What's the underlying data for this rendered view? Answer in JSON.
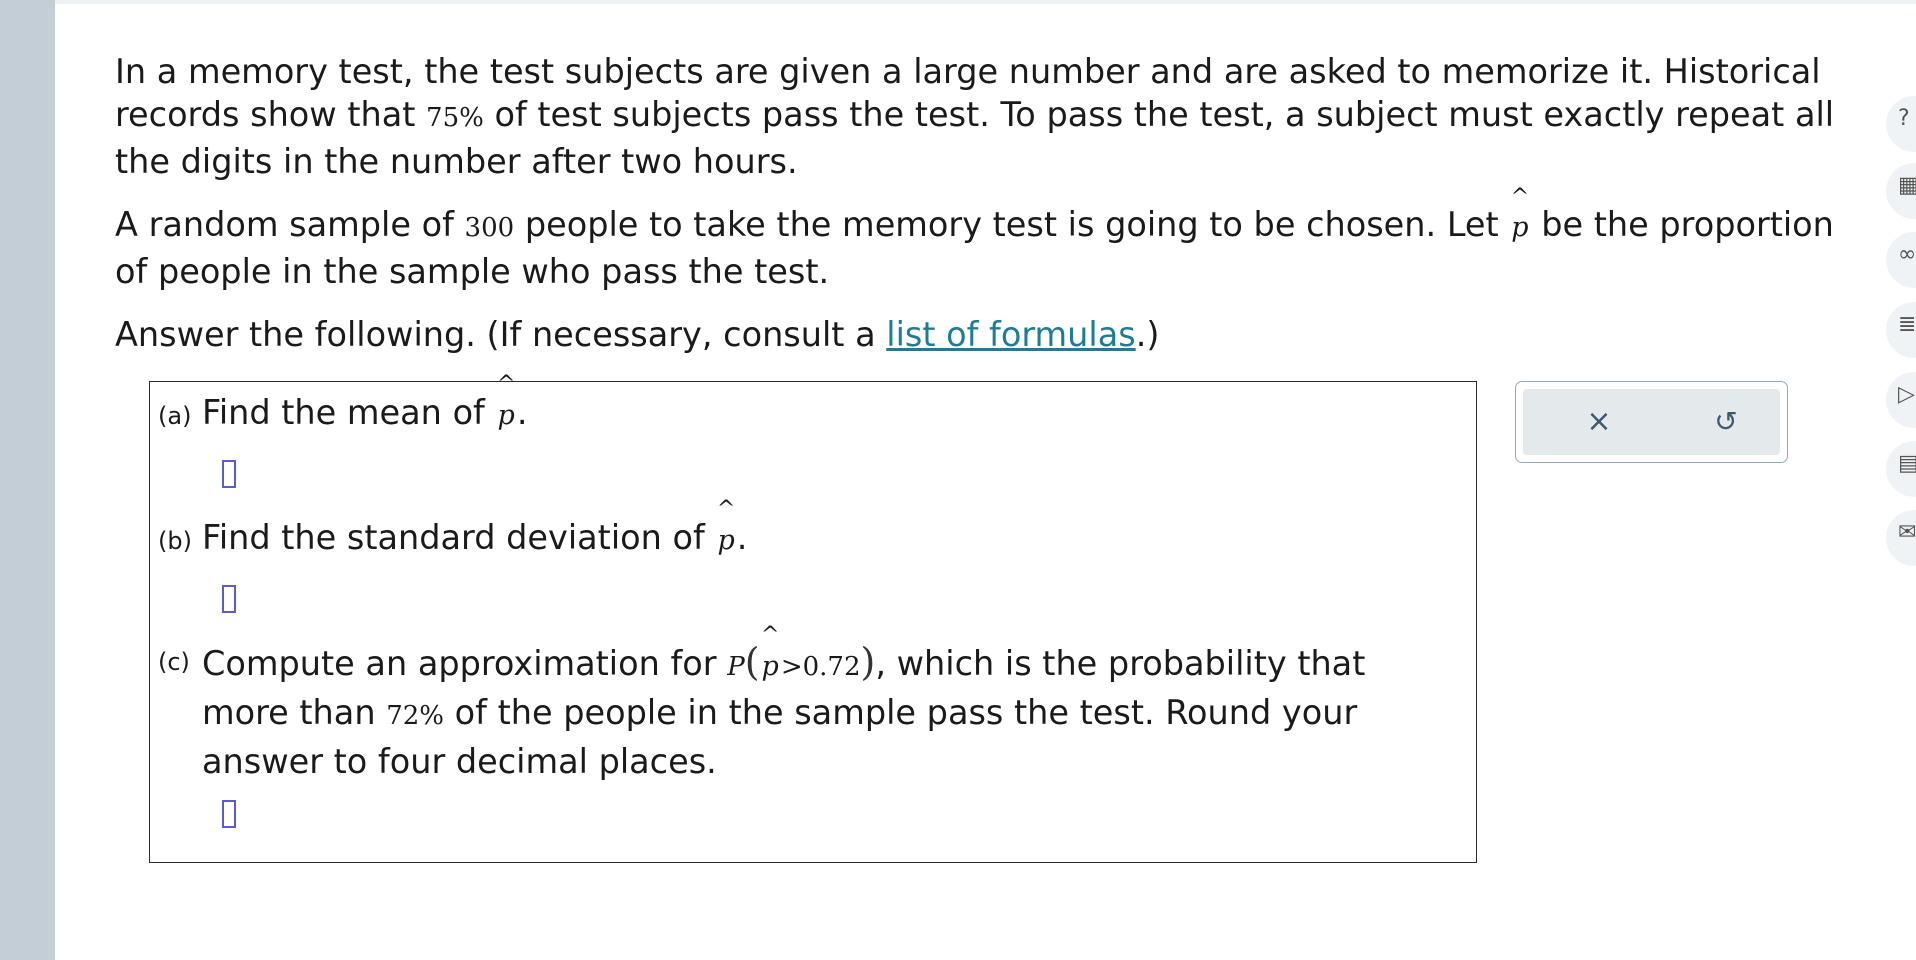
{
  "problem": {
    "para1": {
      "t1": "In a memory test, the test subjects are given a large number and are asked to memorize it. Historical records show that ",
      "pct": "75%",
      "t2": " of test subjects pass the test. To pass the test, a subject must exactly repeat all the digits in the number after two hours."
    },
    "para2": {
      "t1": "A random sample of ",
      "n": "300",
      "t2": " people to take the memory test is going to be chosen. Let ",
      "var": "p",
      "t3": " be the proportion of people in the sample who pass the test."
    },
    "para3": {
      "t1": "Answer the following. (If necessary, consult a ",
      "link": "list of formulas",
      "t2": ".)"
    }
  },
  "questions": {
    "a": {
      "tag": "(a)",
      "text": "Find the mean of ",
      "var": "p",
      "end": "."
    },
    "b": {
      "tag": "(b)",
      "text": "Find the standard deviation of ",
      "var": "p",
      "end": "."
    },
    "c": {
      "tag": "(c)",
      "t1": "Compute an approximation for ",
      "P": "P",
      "var": "p",
      "cmp": ">0.72",
      "t2": ", which is the probability that more than ",
      "pct": "72%",
      "t3": " of the people in the sample pass the test. Round your answer to four decimal places."
    }
  },
  "tools": {
    "clear_icon": "close-icon",
    "reset_icon": "undo-icon",
    "clear_glyph": "×",
    "reset_glyph": "↺"
  },
  "side_icons": [
    {
      "name": "help-icon",
      "glyph": "?"
    },
    {
      "name": "calculator-icon",
      "glyph": "▦"
    },
    {
      "name": "glasses-icon",
      "glyph": "∞"
    },
    {
      "name": "notes-icon",
      "glyph": "≣"
    },
    {
      "name": "video-icon",
      "glyph": "▷"
    },
    {
      "name": "ebook-icon",
      "glyph": "▤"
    },
    {
      "name": "mail-icon",
      "glyph": "✉"
    }
  ],
  "colors": {
    "link": "#1c7d96",
    "answer_box": "#5b5bd6",
    "rail": "#c3ced6",
    "tool_panel": "#e4e9ec"
  }
}
